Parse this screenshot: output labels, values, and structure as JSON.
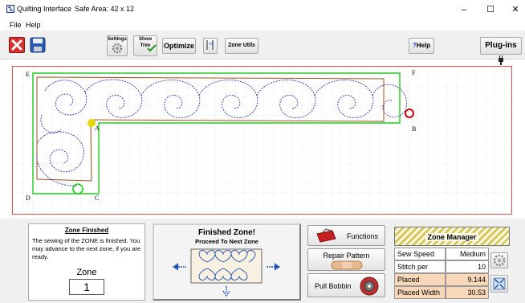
{
  "window": {
    "title": "Quilting Interface",
    "safe_area": "Safe Area: 42 x 12",
    "minimize": "–",
    "maximize": "☐",
    "close": "✕"
  },
  "menu": {
    "file": "File",
    "help": "Help"
  },
  "toolbar": {
    "settings_label": "Settings",
    "show_trim_label_1": "Show",
    "show_trim_label_2": "Trim",
    "optimize_label": "Optimize",
    "zone_utils_label": "Zone Utils",
    "help_label": "Help",
    "help_prefix": "?",
    "plugins_label": "Plug-ins"
  },
  "canvas": {
    "points": {
      "A": "A",
      "B": "B",
      "C": "C",
      "D": "D",
      "E": "E",
      "F": "F"
    }
  },
  "zone_panel": {
    "title": "Zone Finished",
    "message": "The sewing of the ZONE is finished. You may advance to the next zone, if you are ready.",
    "zone_label": "Zone",
    "zone_value": "1"
  },
  "finished_panel": {
    "title": "Finished Zone!",
    "subtitle": "Proceed To Next Zone"
  },
  "functions": {
    "functions_label": "Functions",
    "repair_label": "Repair Pattern",
    "bobbin_label": "Pull Bobbin"
  },
  "zone_manager": {
    "title": "Zone Manager",
    "rows": [
      {
        "label": "Sew Speed",
        "value": "Medium",
        "highlight": false
      },
      {
        "label": "Stitch per Inch",
        "value": "10",
        "highlight": false
      },
      {
        "label": "Placed Height",
        "value": "9.144",
        "highlight": true
      },
      {
        "label": "Placed Width",
        "value": "30.53",
        "highlight": true
      }
    ]
  },
  "colors": {
    "canvas_border": "#e05050",
    "zone_outline": "#22cc22",
    "pattern_stitch": "#3030b0",
    "bound_line": "#a05020",
    "highlight_cell": "#f8d8b8",
    "start_marker": "#e8d400",
    "end_marker": "#cc0000"
  }
}
